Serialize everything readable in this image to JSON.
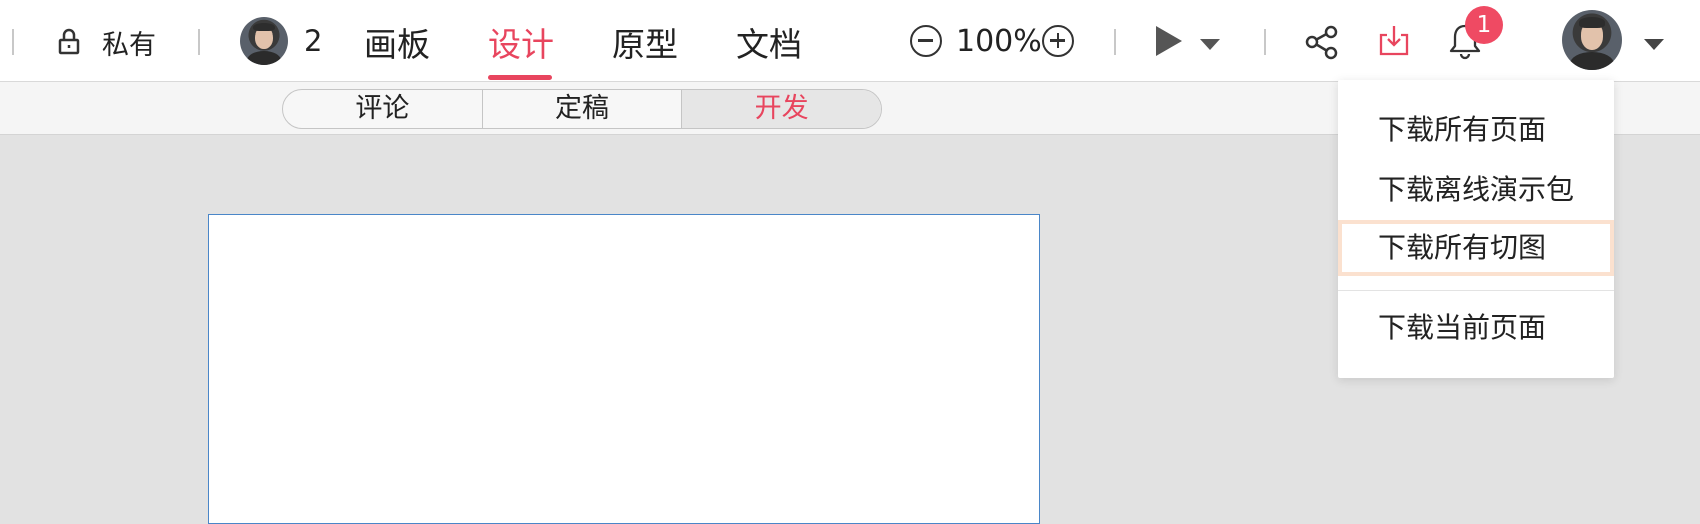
{
  "toolbar": {
    "privacy_label": "私有",
    "collaborator_count": "2",
    "tabs": [
      {
        "label": "画板",
        "active": false
      },
      {
        "label": "设计",
        "active": true
      },
      {
        "label": "原型",
        "active": false
      },
      {
        "label": "文档",
        "active": false
      }
    ],
    "zoom_level": "100%",
    "notification_count": "1",
    "icons": [
      "lock-icon",
      "zoom-out-icon",
      "zoom-in-icon",
      "play-icon",
      "chevron-down-icon",
      "share-icon",
      "download-icon",
      "bell-icon"
    ]
  },
  "subbar": {
    "segments": [
      {
        "label": "评论",
        "active": false
      },
      {
        "label": "定稿",
        "active": false
      },
      {
        "label": "开发",
        "active": true
      }
    ]
  },
  "download_menu": {
    "items": [
      {
        "label": "下载所有页面",
        "highlighted": false
      },
      {
        "label": "下载离线演示包",
        "highlighted": false
      },
      {
        "label": "下载所有切图",
        "highlighted": true
      },
      {
        "label": "下载当前页面",
        "highlighted": false
      }
    ]
  },
  "colors": {
    "accent": "#e8455e",
    "badge": "#ef4a63",
    "artboard_border": "#4a86c8",
    "canvas_bg": "#e2e2e2",
    "highlight_border": "#fbe1cf"
  }
}
